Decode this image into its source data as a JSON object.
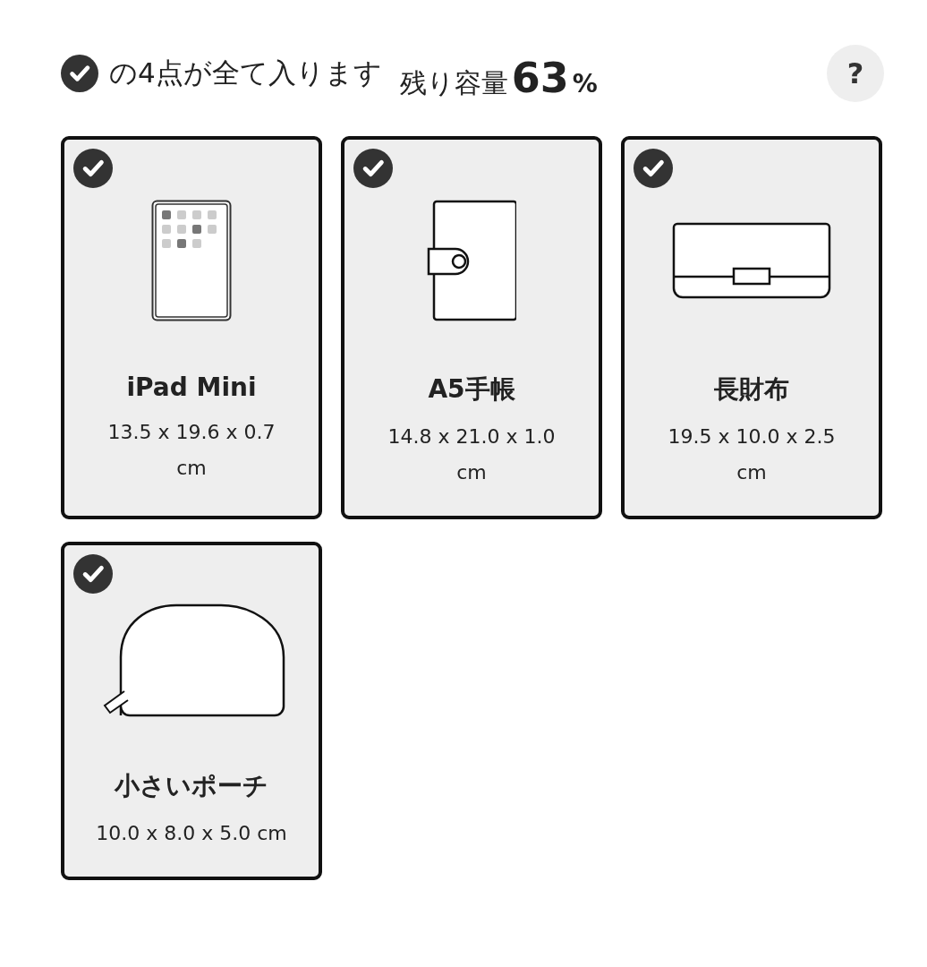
{
  "header": {
    "checked": true,
    "message": "の4点が全て入ります",
    "capacity_label": "残り容量",
    "capacity_value": "63",
    "capacity_unit": "%",
    "help": "?"
  },
  "items": [
    {
      "kind": "tablet",
      "checked": true,
      "name": "iPad Mini",
      "size": "13.5 x 19.6 x 0.7 cm"
    },
    {
      "kind": "planner",
      "checked": true,
      "name": "A5手帳",
      "size": "14.8 x 21.0 x 1.0 cm"
    },
    {
      "kind": "wallet",
      "checked": true,
      "name": "長財布",
      "size": "19.5 x 10.0 x 2.5 cm"
    },
    {
      "kind": "pouch",
      "checked": true,
      "name": "小さいポーチ",
      "size": "10.0 x 8.0 x 5.0 cm"
    }
  ]
}
